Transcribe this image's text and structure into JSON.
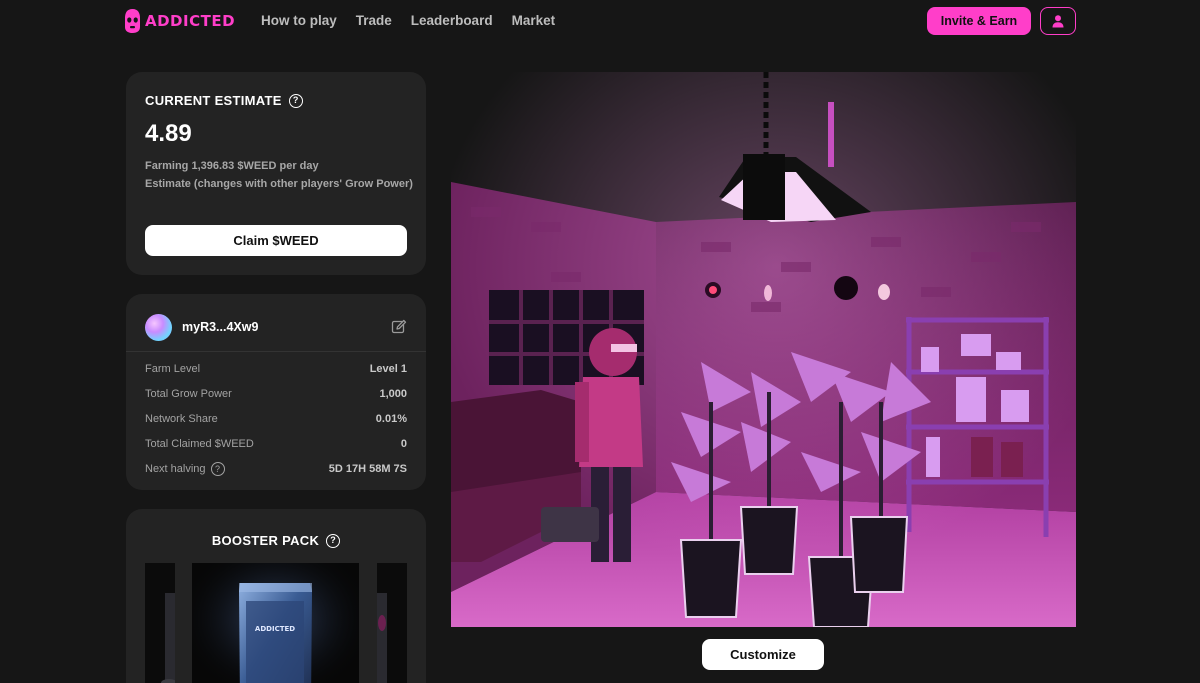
{
  "nav": {
    "brand": "ADDICTED",
    "links": [
      "How to play",
      "Trade",
      "Leaderboard",
      "Market"
    ],
    "invite_label": "Invite & Earn",
    "user_icon": "user-icon"
  },
  "estimate": {
    "title": "CURRENT ESTIMATE",
    "value": "4.89",
    "farming_text": "Farming 1,396.83 $WEED per day",
    "estimate_text": "Estimate (changes with other players' Grow Power)",
    "claim_label": "Claim $WEED"
  },
  "farm": {
    "wallet": "myR3...4Xw9",
    "stats": [
      {
        "label": "Farm Level",
        "value": "Level 1"
      },
      {
        "label": "Total Grow Power",
        "value": "1,000"
      },
      {
        "label": "Network Share",
        "value": "0.01%"
      },
      {
        "label": "Total Claimed $WEED",
        "value": "0"
      },
      {
        "label": "Next halving",
        "value": "5D 17H 58M 7S"
      }
    ]
  },
  "booster": {
    "title": "BOOSTER PACK",
    "pack_label": "ADDICTED"
  },
  "scene": {
    "customize_label": "Customize"
  },
  "colors": {
    "accent": "#ff3ec9",
    "background": "#161616",
    "card": "#232323"
  }
}
